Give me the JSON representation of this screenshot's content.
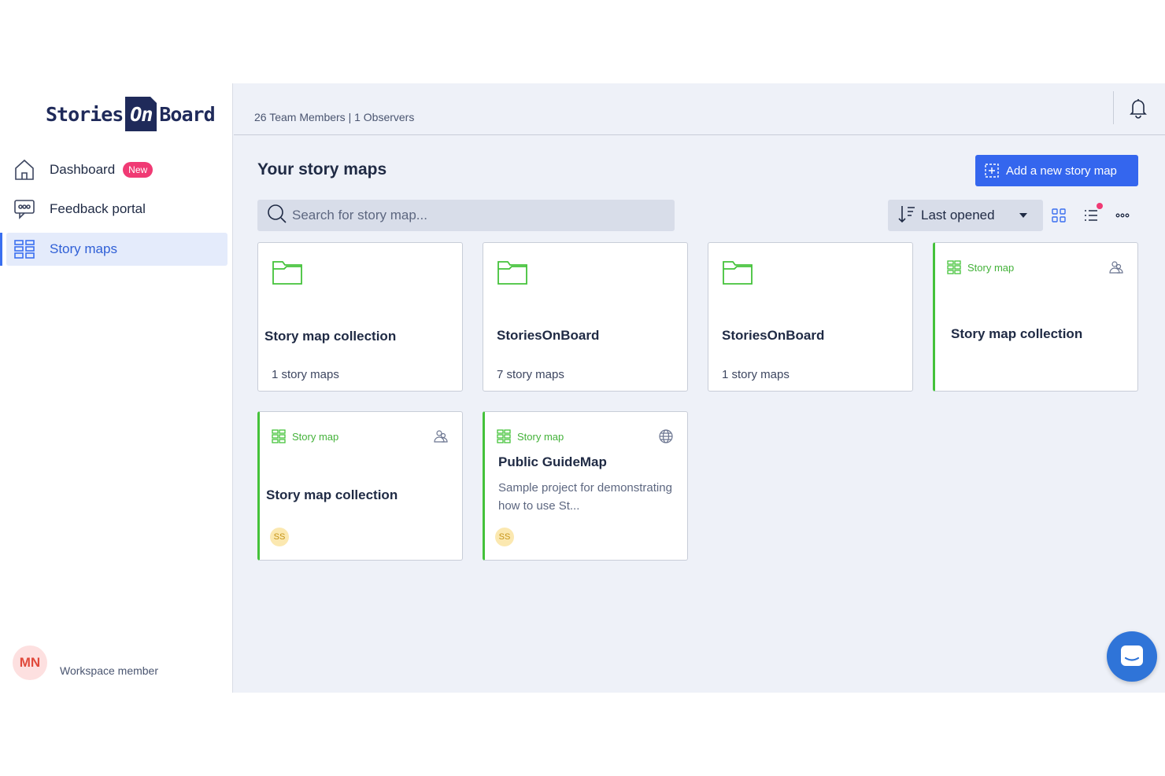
{
  "brand": {
    "part1": "Stories",
    "part2": "On",
    "part3": "Board"
  },
  "sidebar": {
    "items": [
      {
        "label": "Dashboard",
        "badge": "New",
        "icon": "home-icon"
      },
      {
        "label": "Feedback portal",
        "icon": "feedback-icon"
      },
      {
        "label": "Story maps",
        "icon": "story-maps-icon",
        "active": true
      }
    ],
    "member": {
      "initials": "MN",
      "role": "Workspace member"
    }
  },
  "header": {
    "team_info": "26 Team Members | 1 Observers",
    "icon": "bell-icon"
  },
  "main": {
    "title": "Your story maps",
    "add_button": "Add a new story map",
    "search_placeholder": "Search for story map...",
    "sort_label": "Last opened",
    "cards": [
      {
        "type": "folder",
        "title": "Story map collection",
        "count": "1 story maps"
      },
      {
        "type": "folder",
        "title": "StoriesOnBoard",
        "count": "7 story maps"
      },
      {
        "type": "folder",
        "title": "StoriesOnBoard",
        "count": "1 story maps"
      },
      {
        "type": "map",
        "tag": "Story map",
        "title": "Story map collection",
        "icon": "team-icon"
      },
      {
        "type": "map",
        "tag": "Story map",
        "title": "Story map collection",
        "icon": "team-icon",
        "avatar": "SS"
      },
      {
        "type": "map",
        "tag": "Story map",
        "title": "Public GuideMap",
        "description": "Sample project for demonstrating how to use St...",
        "icon": "globe-icon",
        "avatar": "SS"
      }
    ]
  },
  "colors": {
    "accent": "#3466ee",
    "green": "#44c23a",
    "badge": "#f03a74"
  }
}
